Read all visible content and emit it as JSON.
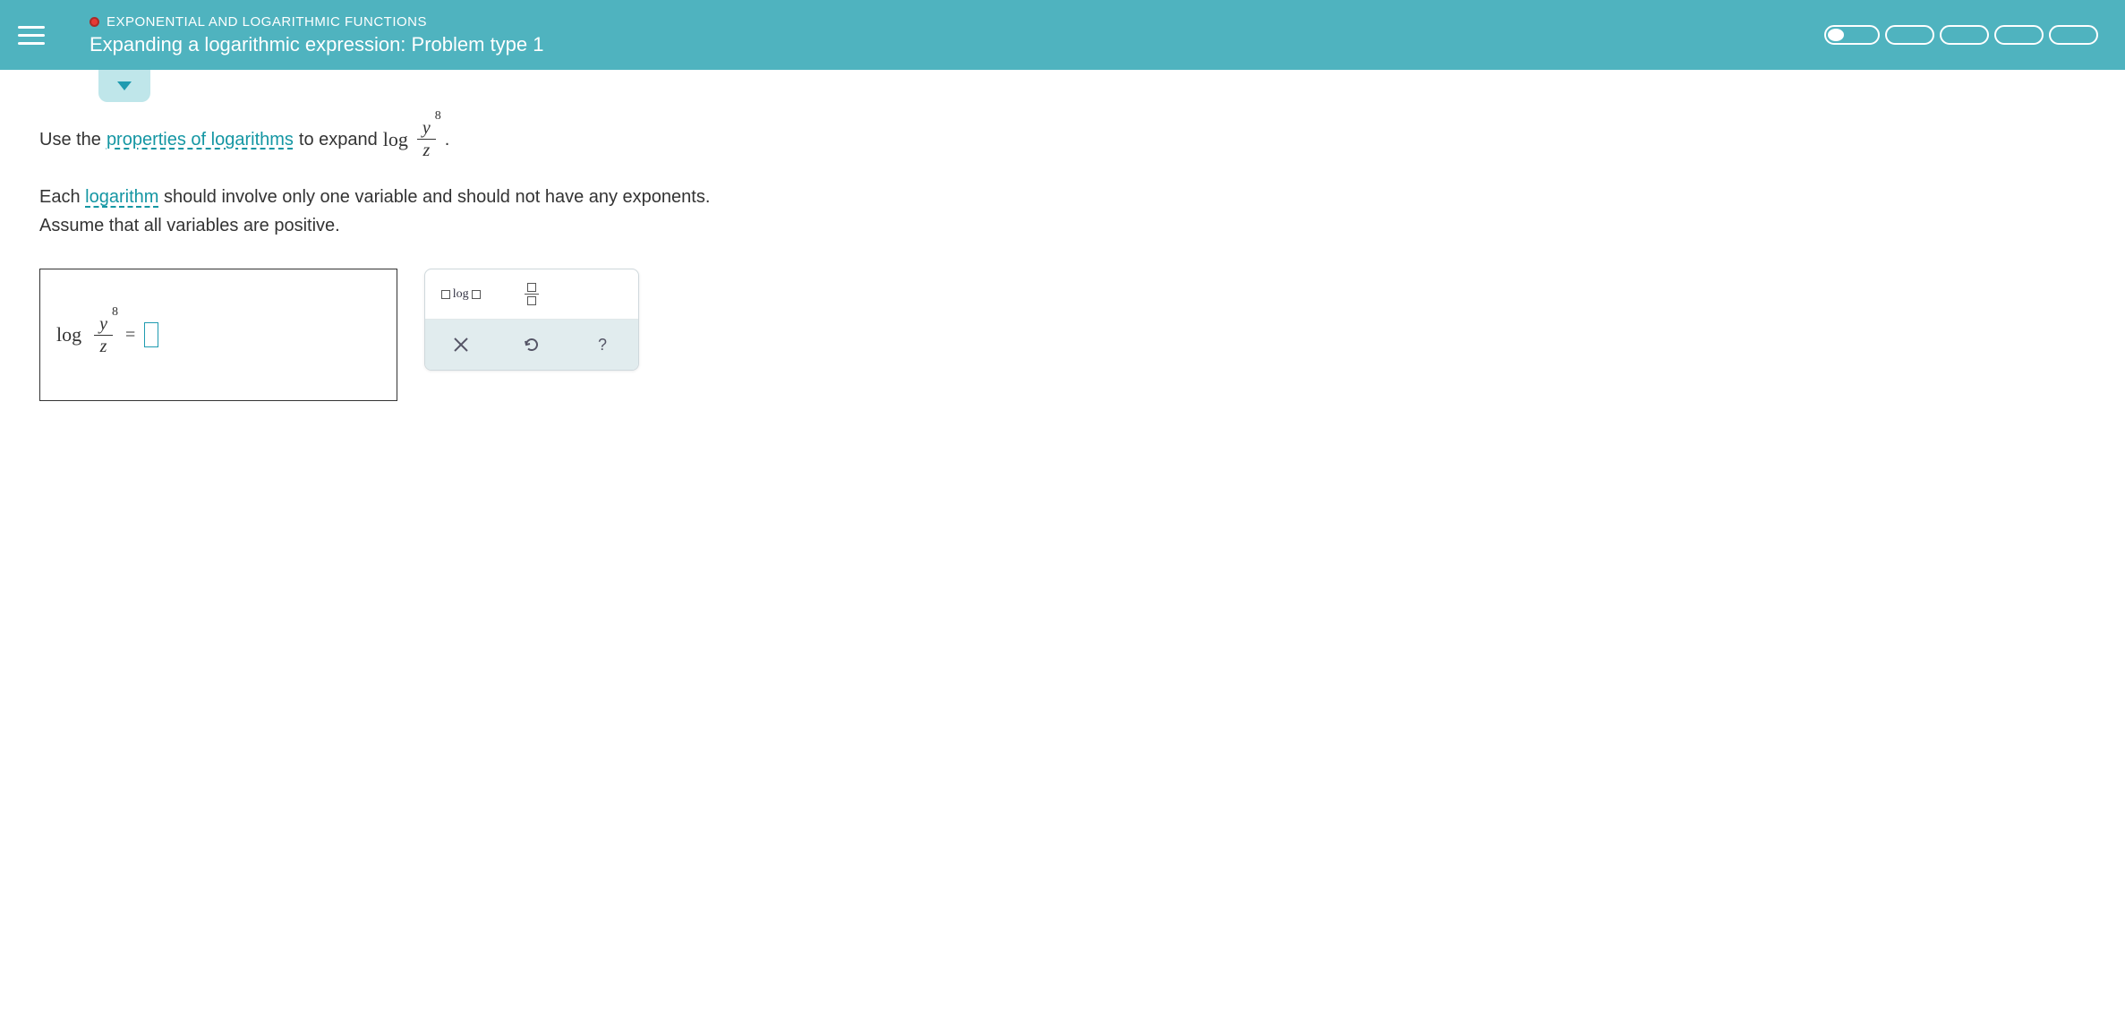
{
  "header": {
    "breadcrumb": "EXPONENTIAL AND LOGARITHMIC FUNCTIONS",
    "title": "Expanding a logarithmic expression: Problem type 1"
  },
  "problem": {
    "prefix": "Use the ",
    "link1": "properties of logarithms",
    "mid": " to expand ",
    "log_label": "log",
    "frac_num_var": "y",
    "frac_num_exp": "8",
    "frac_den": "z",
    "suffix": ".",
    "line2a": "Each ",
    "link2": "logarithm",
    "line2b": " should involve only one variable and should not have any exponents.",
    "line3": "Assume that all variables are positive."
  },
  "answer": {
    "log_label": "log",
    "frac_num_var": "y",
    "frac_num_exp": "8",
    "frac_den": "z",
    "equals": "="
  },
  "toolbox": {
    "log_label": "log"
  }
}
